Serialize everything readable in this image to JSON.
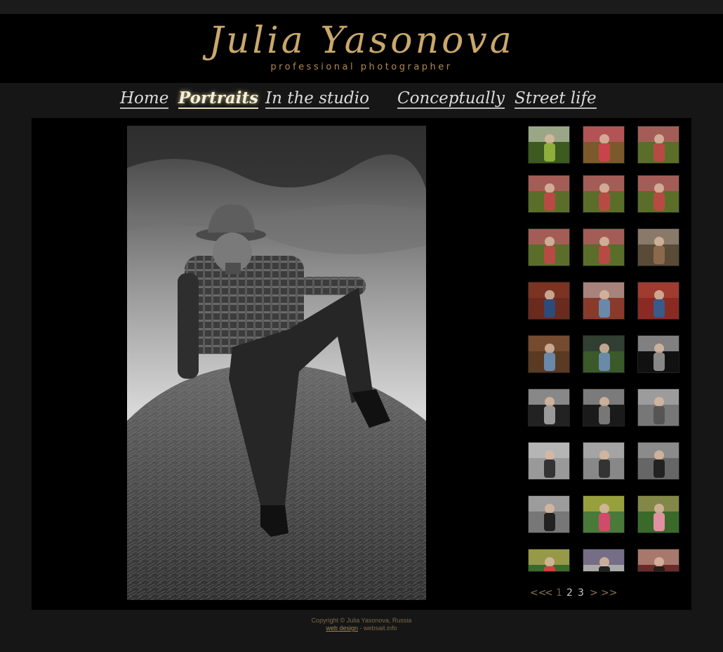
{
  "header": {
    "name": "Julia Yasonova",
    "tagline": "professional photographer"
  },
  "nav": {
    "items": [
      {
        "label": "Home",
        "active": false
      },
      {
        "label": "Portraits",
        "active": true
      },
      {
        "label": "In the studio",
        "active": false
      },
      {
        "label": "Conceptually",
        "active": false
      },
      {
        "label": "Street life",
        "active": false
      }
    ]
  },
  "gallery": {
    "main_photo": "cowboy-on-haystack-bw",
    "thumbnails": [
      "girl-white-dress-field",
      "girl-pink-hat-field",
      "girl-pink-hat-field",
      "girl-pink-hat-field",
      "girl-pink-hat-field",
      "girl-pink-hat-field",
      "girl-pink-hat-field",
      "girl-pink-hat-field-double",
      "boy-sitting-ruins",
      "boy-cap-red-wall",
      "boy-red-wall",
      "boy-red-door",
      "boy-brick-wall",
      "boy-green-vest",
      "woman-bw-window",
      "woman-bw-portrait",
      "woman-bw-doorway",
      "cowboy-haystack-small",
      "cowboy-haystack-small",
      "cowboy-close-up",
      "cowboy-with-horse",
      "cowboy-with-horse",
      "girl-swing",
      "girl-with-teddy-bear",
      "girl-flowers",
      "woman-dark-hair",
      "woman-red-lips"
    ]
  },
  "pager": {
    "first": "<<",
    "prev": "<",
    "pages": [
      "1",
      "2",
      "3"
    ],
    "current": "1",
    "next": ">",
    "last": ">>"
  },
  "footer": {
    "copyright": "Copyright © Julia Yasonova, Russia",
    "design_link": "web design",
    "design_suffix": " - websait.info"
  },
  "colors": {
    "gold": "#c9a86c",
    "background": "#161616",
    "panel": "#000000"
  }
}
